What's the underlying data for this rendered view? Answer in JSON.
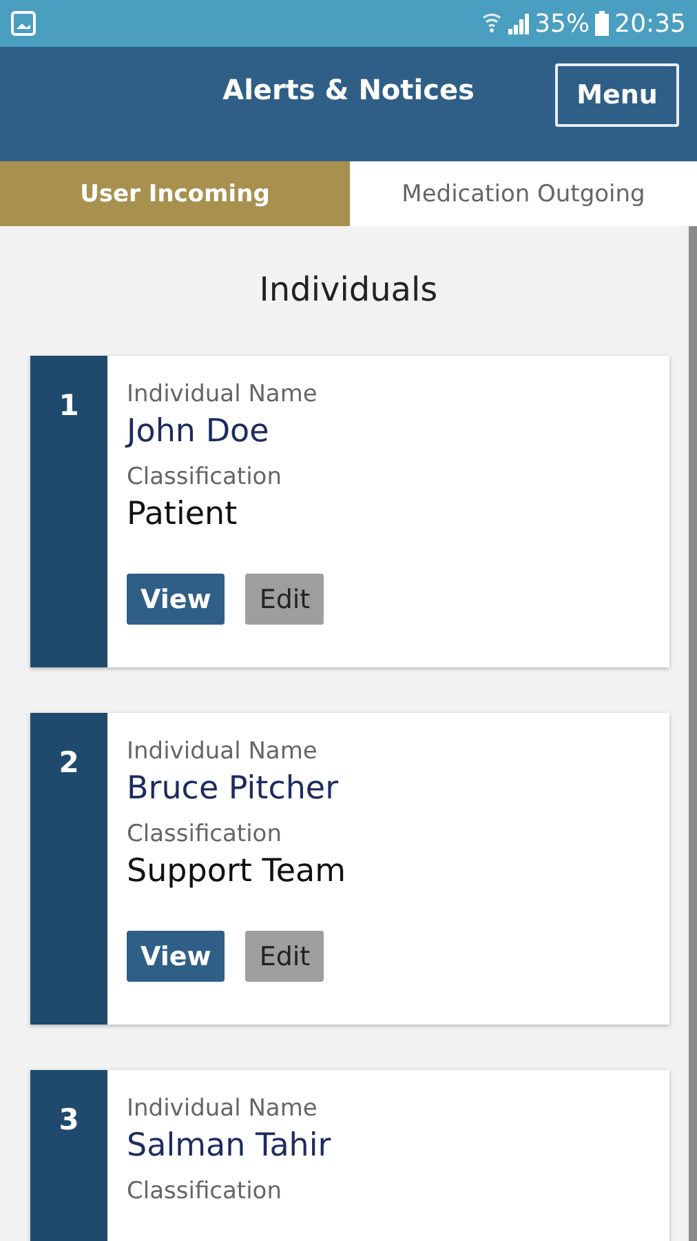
{
  "status_bar": {
    "battery": "35%",
    "time": "20:35"
  },
  "header": {
    "title": "Alerts & Notices",
    "menu_button": "Menu"
  },
  "tabs": [
    {
      "label": "User Incoming",
      "selected": true
    },
    {
      "label": "Medication Outgoing",
      "selected": false
    }
  ],
  "section_title": "Individuals",
  "individuals": [
    {
      "number": "1",
      "name_label": "Individual Name",
      "name": "John Doe",
      "class_label": "Classification",
      "classification": "Patient",
      "buttons": [
        "View",
        "Edit"
      ]
    },
    {
      "number": "2",
      "name_label": "Individual Name",
      "name": "Bruce Pitcher",
      "class_label": "Classification",
      "classification": "Support Team",
      "buttons": [
        "View",
        "Edit"
      ]
    },
    {
      "number": "3",
      "name_label": "Individual Name",
      "name": "Salman Tahir",
      "class_label": "Classification"
    }
  ]
}
